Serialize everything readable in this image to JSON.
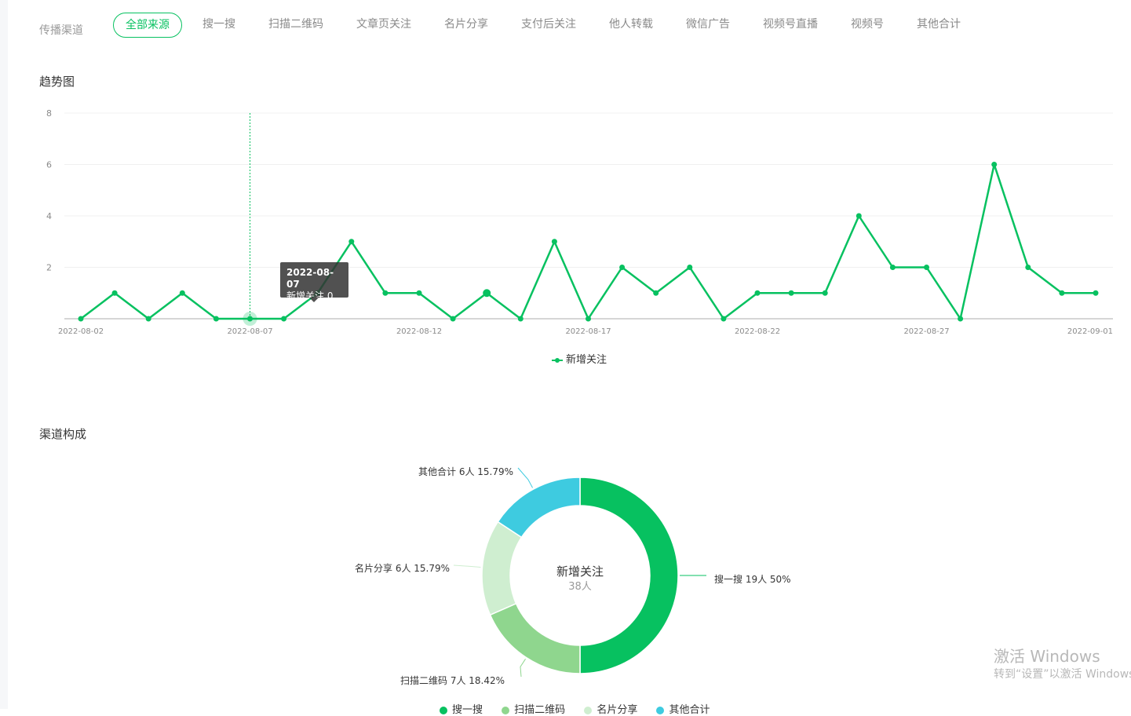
{
  "filter": {
    "label": "传播渠道",
    "tabs": [
      {
        "label": "全部来源",
        "active": true
      },
      {
        "label": "搜一搜"
      },
      {
        "label": "扫描二维码"
      },
      {
        "label": "文章页关注"
      },
      {
        "label": "名片分享"
      },
      {
        "label": "支付后关注"
      },
      {
        "label": "他人转载"
      },
      {
        "label": "微信广告"
      },
      {
        "label": "视频号直播"
      },
      {
        "label": "视频号"
      },
      {
        "label": "其他合计"
      }
    ]
  },
  "trend": {
    "title": "趋势图",
    "tooltip": {
      "date": "2022-08-07",
      "text": "新增关注 0"
    }
  },
  "composition": {
    "title": "渠道构成",
    "center_title": "新增关注",
    "center_value": "38人",
    "labels": [
      "搜一搜 19人 50%",
      "扫描二维码 7人 18.42%",
      "名片分享 6人 15.79%",
      "其他合计 6人 15.79%"
    ],
    "legend": [
      "搜一搜",
      "扫描二维码",
      "名片分享",
      "其他合计"
    ]
  },
  "watermark": {
    "line1": "激活 Windows",
    "line2": "转到“设置”以激活 Windows"
  },
  "colors": {
    "accent": "#07c160",
    "pie": [
      "#07c160",
      "#8fd68e",
      "#cfeed0",
      "#3ecbe0"
    ]
  },
  "chart_data": [
    {
      "type": "line",
      "title": "",
      "x": [
        "2022-08-02",
        "2022-08-03",
        "2022-08-04",
        "2022-08-05",
        "2022-08-06",
        "2022-08-07",
        "2022-08-08",
        "2022-08-09",
        "2022-08-10",
        "2022-08-11",
        "2022-08-12",
        "2022-08-13",
        "2022-08-14",
        "2022-08-15",
        "2022-08-16",
        "2022-08-17",
        "2022-08-18",
        "2022-08-19",
        "2022-08-20",
        "2022-08-21",
        "2022-08-22",
        "2022-08-23",
        "2022-08-24",
        "2022-08-25",
        "2022-08-26",
        "2022-08-27",
        "2022-08-28",
        "2022-08-29",
        "2022-08-30",
        "2022-08-31",
        "2022-09-01"
      ],
      "x_ticks": [
        "2022-08-02",
        "2022-08-07",
        "2022-08-12",
        "2022-08-17",
        "2022-08-22",
        "2022-08-27",
        "2022-09-01"
      ],
      "y_ticks": [
        2,
        4,
        6,
        8
      ],
      "series": [
        {
          "name": "新增关注",
          "values": [
            0,
            1,
            0,
            1,
            0,
            0,
            0,
            1,
            3,
            1,
            1,
            0,
            1,
            0,
            3,
            0,
            2,
            1,
            2,
            0,
            1,
            1,
            1,
            4,
            2,
            2,
            0,
            6,
            2,
            1,
            1
          ]
        }
      ],
      "ylim": [
        0,
        8
      ],
      "grid": true,
      "legend": "bottom-center",
      "highlight_index": 5
    },
    {
      "type": "pie",
      "donut": true,
      "categories": [
        "搜一搜",
        "扫描二维码",
        "名片分享",
        "其他合计"
      ],
      "values": [
        19,
        7,
        6,
        6
      ],
      "percents": [
        50,
        18.42,
        15.79,
        15.79
      ],
      "legend": "bottom-center"
    }
  ]
}
